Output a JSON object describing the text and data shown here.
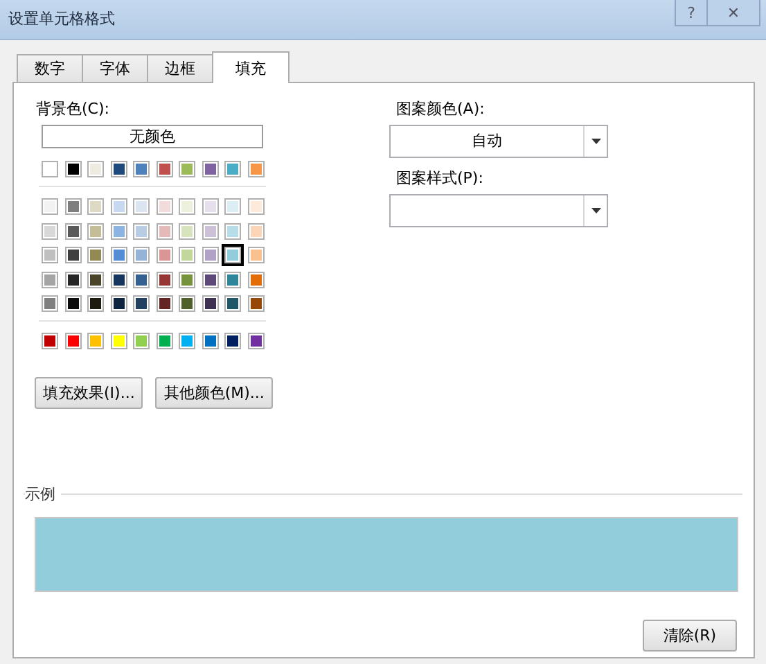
{
  "window": {
    "title": "设置单元格格式"
  },
  "title_buttons": [
    {
      "kind": "help",
      "label": "?"
    },
    {
      "kind": "close",
      "label": "✕"
    }
  ],
  "tabs": [
    {
      "label": "数字",
      "selected": false
    },
    {
      "label": "字体",
      "selected": false
    },
    {
      "label": "边框",
      "selected": false
    },
    {
      "label": "填充",
      "selected": true
    }
  ],
  "background": {
    "label": "背景色(C):",
    "no_color_button": "无颜色",
    "theme_colors": [
      {
        "color": "#ffffff",
        "selected": false
      },
      {
        "color": "#000000",
        "selected": false
      },
      {
        "color": "#eeece1",
        "selected": false
      },
      {
        "color": "#1f497d",
        "selected": false
      },
      {
        "color": "#4f81bd",
        "selected": false
      },
      {
        "color": "#c0504d",
        "selected": false
      },
      {
        "color": "#9bbb59",
        "selected": false
      },
      {
        "color": "#8064a2",
        "selected": false
      },
      {
        "color": "#4bacc6",
        "selected": false
      },
      {
        "color": "#f79646",
        "selected": false
      }
    ],
    "tint_rows": [
      [
        {
          "color": "#f2f2f2",
          "selected": false
        },
        {
          "color": "#7f7f7f",
          "selected": false
        },
        {
          "color": "#ddd9c3",
          "selected": false
        },
        {
          "color": "#c6d9f0",
          "selected": false
        },
        {
          "color": "#dbe5f1",
          "selected": false
        },
        {
          "color": "#f2dcdb",
          "selected": false
        },
        {
          "color": "#ebf1dd",
          "selected": false
        },
        {
          "color": "#e5e0ec",
          "selected": false
        },
        {
          "color": "#dbeef3",
          "selected": false
        },
        {
          "color": "#fdeada",
          "selected": false
        }
      ],
      [
        {
          "color": "#d8d8d8",
          "selected": false
        },
        {
          "color": "#595959",
          "selected": false
        },
        {
          "color": "#c4bd97",
          "selected": false
        },
        {
          "color": "#8db3e2",
          "selected": false
        },
        {
          "color": "#b8cce4",
          "selected": false
        },
        {
          "color": "#e5b9b7",
          "selected": false
        },
        {
          "color": "#d7e3bc",
          "selected": false
        },
        {
          "color": "#ccc1d9",
          "selected": false
        },
        {
          "color": "#b7dde8",
          "selected": false
        },
        {
          "color": "#fbd5b5",
          "selected": false
        }
      ],
      [
        {
          "color": "#bfbfbf",
          "selected": false
        },
        {
          "color": "#3f3f3f",
          "selected": false
        },
        {
          "color": "#938953",
          "selected": false
        },
        {
          "color": "#548dd4",
          "selected": false
        },
        {
          "color": "#95b3d7",
          "selected": false
        },
        {
          "color": "#d99694",
          "selected": false
        },
        {
          "color": "#c3d69b",
          "selected": false
        },
        {
          "color": "#b2a2c7",
          "selected": false
        },
        {
          "color": "#92cddc",
          "selected": true
        },
        {
          "color": "#fac08f",
          "selected": false
        }
      ],
      [
        {
          "color": "#a5a5a5",
          "selected": false
        },
        {
          "color": "#262626",
          "selected": false
        },
        {
          "color": "#494429",
          "selected": false
        },
        {
          "color": "#17365d",
          "selected": false
        },
        {
          "color": "#366092",
          "selected": false
        },
        {
          "color": "#953734",
          "selected": false
        },
        {
          "color": "#76923c",
          "selected": false
        },
        {
          "color": "#5f497a",
          "selected": false
        },
        {
          "color": "#31859b",
          "selected": false
        },
        {
          "color": "#e36c09",
          "selected": false
        }
      ],
      [
        {
          "color": "#7f7f7f",
          "selected": false
        },
        {
          "color": "#0c0c0c",
          "selected": false
        },
        {
          "color": "#1d1b10",
          "selected": false
        },
        {
          "color": "#0f243e",
          "selected": false
        },
        {
          "color": "#244061",
          "selected": false
        },
        {
          "color": "#632423",
          "selected": false
        },
        {
          "color": "#4f6128",
          "selected": false
        },
        {
          "color": "#3f3151",
          "selected": false
        },
        {
          "color": "#205867",
          "selected": false
        },
        {
          "color": "#974806",
          "selected": false
        }
      ]
    ],
    "standard_colors": [
      {
        "color": "#c00000",
        "selected": false
      },
      {
        "color": "#ff0000",
        "selected": false
      },
      {
        "color": "#ffc000",
        "selected": false
      },
      {
        "color": "#ffff00",
        "selected": false
      },
      {
        "color": "#92d050",
        "selected": false
      },
      {
        "color": "#00b050",
        "selected": false
      },
      {
        "color": "#00b0f0",
        "selected": false
      },
      {
        "color": "#0070c0",
        "selected": false
      },
      {
        "color": "#002060",
        "selected": false
      },
      {
        "color": "#7030a0",
        "selected": false
      }
    ],
    "buttons": [
      "填充效果(I)...",
      "其他颜色(M)..."
    ]
  },
  "pattern_color": {
    "label": "图案颜色(A):",
    "value": "自动"
  },
  "pattern_style": {
    "label": "图案样式(P):"
  },
  "sample": {
    "label": "示例"
  },
  "clear_button": "清除(R)"
}
